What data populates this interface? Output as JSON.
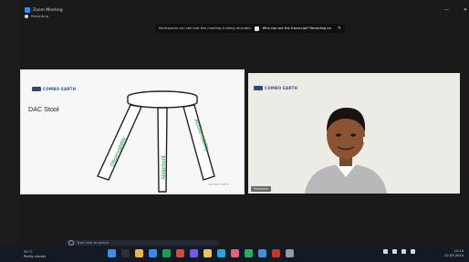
{
  "window": {
    "title": "Zoom Meeting",
    "status": "Recording",
    "controls": [
      "—",
      "✕"
    ]
  },
  "notification": {
    "text": "Participants can see that this meeting is being recorded",
    "action": "Who can see the transcript? Recording on",
    "close": "×"
  },
  "slide": {
    "brand": "COMBO EARTH",
    "title": "DAC Stool",
    "legs": [
      "Observability",
      "Alignment",
      "Accountability"
    ],
    "watermark": "combo earth"
  },
  "camera": {
    "brand": "COMBO EARTH",
    "name_tag": "Presenter"
  },
  "taskbar": {
    "weather_line1": "31°C",
    "weather_line2": "Partly cloudy",
    "search_placeholder": "Type here to search",
    "clock_time": "10:14",
    "clock_date": "22-03-2024"
  },
  "colors": {
    "zoom_blue": "#2d8cff",
    "leg_text_green": "#1f8a3b",
    "stage_background": "#1a1a1a"
  }
}
